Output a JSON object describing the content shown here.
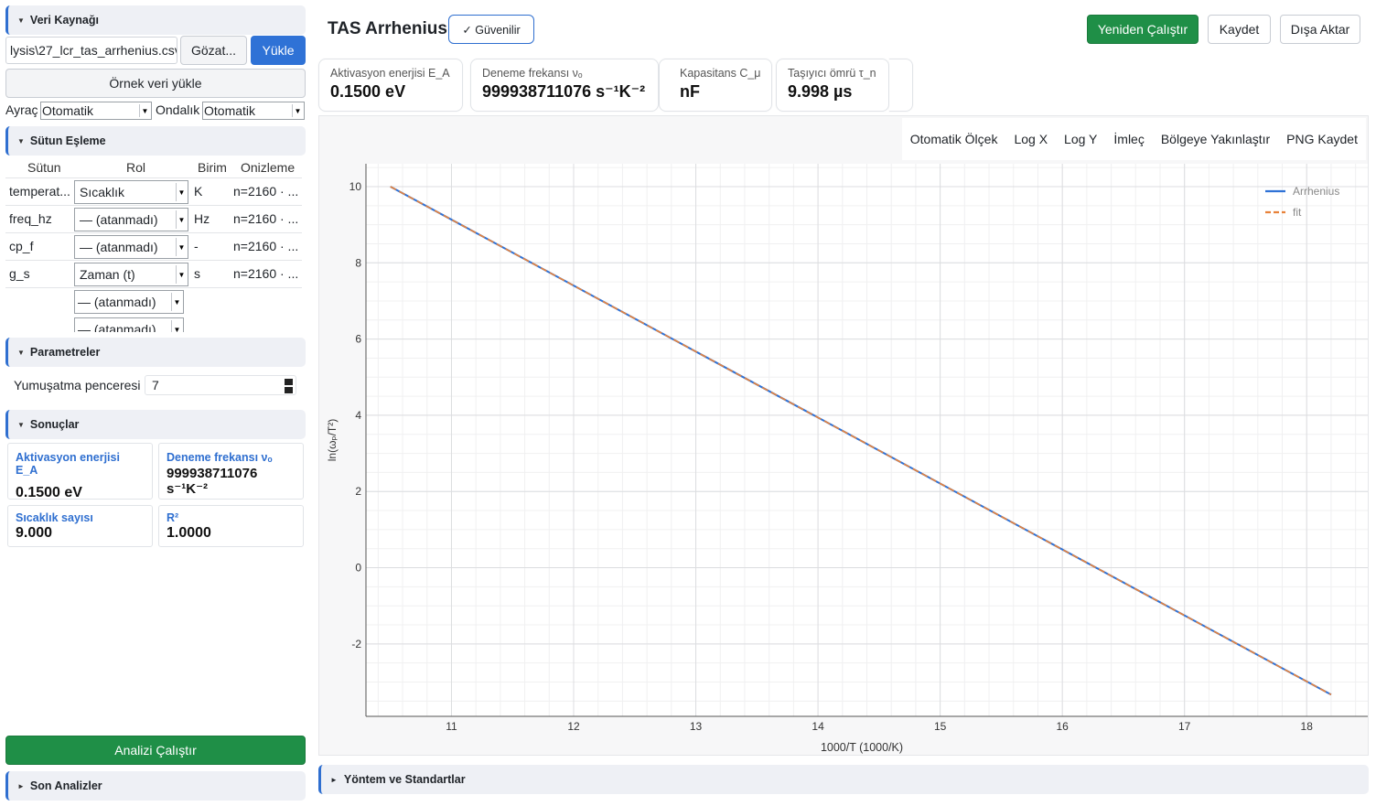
{
  "sidebar": {
    "data_source": {
      "title": "Veri Kaynağı",
      "file_path": "lysis\\27_lcr_tas_arrhenius.csv",
      "browse_label": "Gözat...",
      "load_label": "Yükle",
      "sample_label": "Örnek veri yükle",
      "sep_label": "Ayraç",
      "sep_value": "Otomatik",
      "dec_label": "Ondalık",
      "dec_value": "Otomatik"
    },
    "mapping": {
      "title": "Sütun Eşleme",
      "headers": [
        "Sütun",
        "Rol",
        "Birim",
        "Onizleme"
      ],
      "rows": [
        {
          "col": "temperat...",
          "role": "Sıcaklık",
          "unit": "K",
          "preview": "n=2160 · ..."
        },
        {
          "col": "freq_hz",
          "role": "— (atanmadı)",
          "unit": "Hz",
          "preview": "n=2160 · ..."
        },
        {
          "col": "cp_f",
          "role": "— (atanmadı)",
          "unit": "-",
          "preview": "n=2160 · ..."
        },
        {
          "col": "g_s",
          "role": "Zaman (t)",
          "unit": "s",
          "preview": "n=2160 · ..."
        }
      ],
      "extra_roles": [
        "— (atanmadı)",
        "— (atanmadı)"
      ]
    },
    "params": {
      "title": "Parametreler",
      "smooth_label": "Yumuşatma penceresi",
      "smooth_value": "7"
    },
    "results": {
      "title": "Sonuçlar",
      "cards": [
        {
          "key": "Aktivasyon enerjisi E_A",
          "value": "0.1500 eV"
        },
        {
          "key": "Deneme frekansı νₒ",
          "value": "999938711076 s⁻¹K⁻²"
        },
        {
          "key": "Sıcaklık sayısı",
          "value": "9.000"
        },
        {
          "key": "R²",
          "value": "1.0000"
        }
      ]
    },
    "run_label": "Analizi Çalıştır",
    "recent_title": "Son Analizler"
  },
  "header": {
    "title": "TAS Arrhenius",
    "badge": "✓ Güvenilir",
    "rerun_label": "Yeniden Çalıştır",
    "save_label": "Kaydet",
    "export_label": "Dışa Aktar"
  },
  "metrics": [
    {
      "key": "Aktivasyon enerjisi E_A",
      "value": "0.1500 eV"
    },
    {
      "key": "Deneme frekansı νₒ",
      "value": "999938711076 s⁻¹K⁻²"
    },
    {
      "key": "Kapasitans C_μ",
      "value": "nF"
    },
    {
      "key": "Taşıyıcı ömrü τ_n",
      "value": "9.998 µs"
    }
  ],
  "toolbar": {
    "autoscale": "Otomatik Ölçek",
    "logx": "Log X",
    "logy": "Log Y",
    "cursor": "İmleç",
    "zoom": "Bölgeye Yakınlaştır",
    "png": "PNG Kaydet"
  },
  "bottom_section": "Yöntem ve Standartlar",
  "colors": {
    "accent": "#2f6fd0",
    "green": "#1f8f47",
    "series_arrhenius": "#2f72d6",
    "series_fit": "#e8823a"
  },
  "chart_data": {
    "type": "line",
    "xlabel": "1000/T (1000/K)",
    "ylabel": "ln(ωₚ/T²)",
    "xlim": [
      10.3,
      18.5
    ],
    "ylim": [
      -3.9,
      10.6
    ],
    "xticks": [
      11,
      12,
      13,
      14,
      15,
      16,
      17,
      18
    ],
    "yticks": [
      -2,
      0,
      2,
      4,
      6,
      8,
      10
    ],
    "grid": true,
    "legend": "top-right",
    "series": [
      {
        "name": "Arrhenius",
        "style": "solid",
        "x": [
          10.5,
          18.2
        ],
        "y": [
          10.0,
          -3.33
        ]
      },
      {
        "name": "fit",
        "style": "dashed",
        "x": [
          10.5,
          18.2
        ],
        "y": [
          10.0,
          -3.33
        ]
      }
    ]
  }
}
